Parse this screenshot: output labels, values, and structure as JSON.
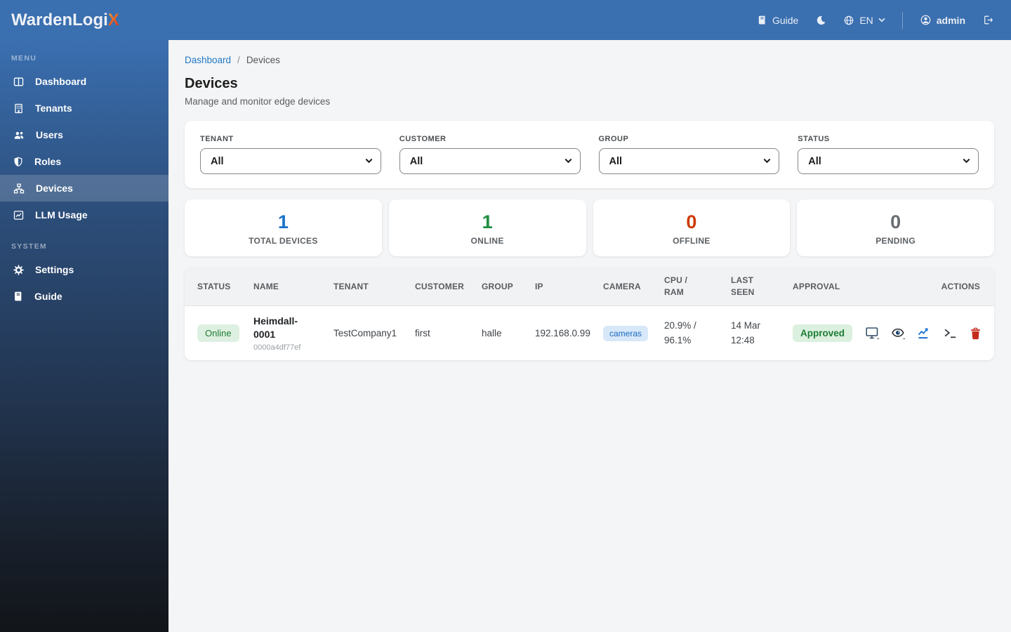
{
  "app": {
    "brand_main": "WardenLogi",
    "brand_x": "X",
    "accent_color": "#3a6fb0"
  },
  "topbar": {
    "guide": {
      "icon": "book-icon",
      "label": "Guide"
    },
    "theme_toggle_icon": "moon-icon",
    "language": {
      "icon": "globe-icon",
      "value": "EN",
      "caret_icon": "caret-down-icon"
    },
    "user": {
      "icon": "person-circle-icon",
      "name": "admin"
    },
    "logout_icon": "box-arrow-right-icon"
  },
  "sidebar": {
    "menu_label": "MENU",
    "system_label": "SYSTEM",
    "menu_items": [
      {
        "label": "Dashboard",
        "icon": "dashboard-icon",
        "active": false
      },
      {
        "label": "Tenants",
        "icon": "building-icon",
        "active": false
      },
      {
        "label": "Users",
        "icon": "users-icon",
        "active": false
      },
      {
        "label": "Roles",
        "icon": "shield-icon",
        "active": false
      },
      {
        "label": "Devices",
        "icon": "sitemap-icon",
        "active": true
      },
      {
        "label": "LLM Usage",
        "icon": "chart-line-icon",
        "active": false
      }
    ],
    "system_items": [
      {
        "label": "Settings",
        "icon": "gear-icon",
        "active": false
      },
      {
        "label": "Guide",
        "icon": "book-icon",
        "active": false
      }
    ]
  },
  "breadcrumb": {
    "parent": "Dashboard",
    "separator": "/",
    "current": "Devices"
  },
  "page": {
    "title": "Devices",
    "subtitle": "Manage and monitor edge devices"
  },
  "filters": [
    {
      "label": "TENANT",
      "value": "All"
    },
    {
      "label": "CUSTOMER",
      "value": "All"
    },
    {
      "label": "GROUP",
      "value": "All"
    },
    {
      "label": "STATUS",
      "value": "All"
    }
  ],
  "stats": [
    {
      "value": "1",
      "label": "TOTAL DEVICES",
      "color": "#1a73c8"
    },
    {
      "value": "1",
      "label": "ONLINE",
      "color": "#1e8e3e"
    },
    {
      "value": "0",
      "label": "OFFLINE",
      "color": "#cc3a0a"
    },
    {
      "value": "0",
      "label": "PENDING",
      "color": "#686d72"
    }
  ],
  "table": {
    "columns": [
      "STATUS",
      "NAME",
      "TENANT",
      "CUSTOMER",
      "GROUP",
      "IP",
      "CAMERA",
      "CPU / RAM",
      "LAST SEEN",
      "APPROVAL",
      "ACTIONS"
    ],
    "rows": [
      {
        "status": "Online",
        "status_color": "#1c7c33",
        "name": "Heimdall-0001",
        "device_id": "0000a4df77ef",
        "tenant": "TestCompany1",
        "customer": "first",
        "group": "halle",
        "ip": "192.168.0.99",
        "camera": "cameras",
        "cpu_ram": "20.9% / 96.1%",
        "last_seen": "14 Mar 12:48",
        "approval": "Approved",
        "action_icons": [
          "monitor-icon",
          "eye-icon",
          "chart-icon",
          "terminal-icon",
          "trash-icon"
        ]
      }
    ]
  }
}
